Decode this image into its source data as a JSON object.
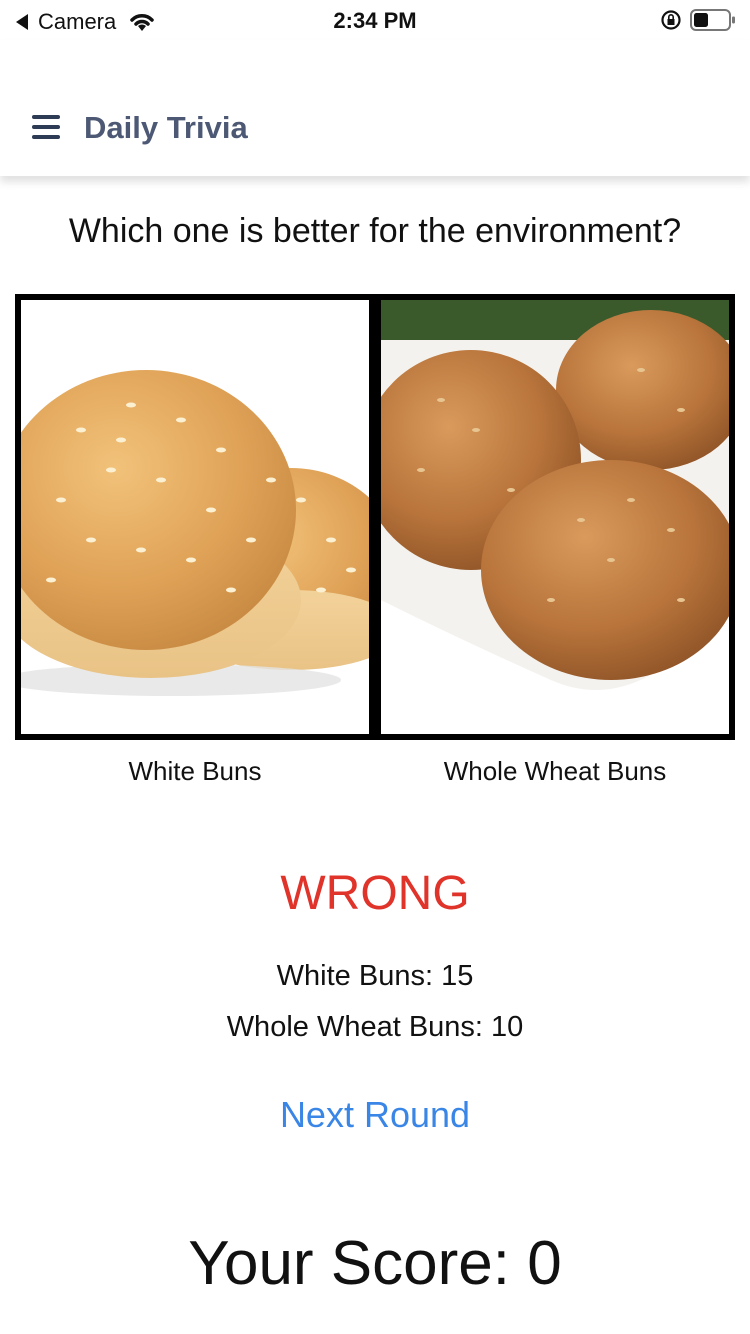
{
  "status_bar": {
    "back_label": "Camera",
    "time": "2:34 PM"
  },
  "nav": {
    "title": "Daily Trivia"
  },
  "question": "Which one is better for the environment?",
  "choices": [
    {
      "label": "White Buns"
    },
    {
      "label": "Whole Wheat Buns"
    }
  ],
  "result": {
    "text": "WRONG",
    "color": "#e0332a"
  },
  "counts": {
    "first": "White Buns: 15",
    "second": "Whole Wheat Buns: 10"
  },
  "next_button": "Next Round",
  "score": "Your Score: 0",
  "colors": {
    "accent_link": "#3a86e6",
    "nav_title": "#4c5874"
  }
}
